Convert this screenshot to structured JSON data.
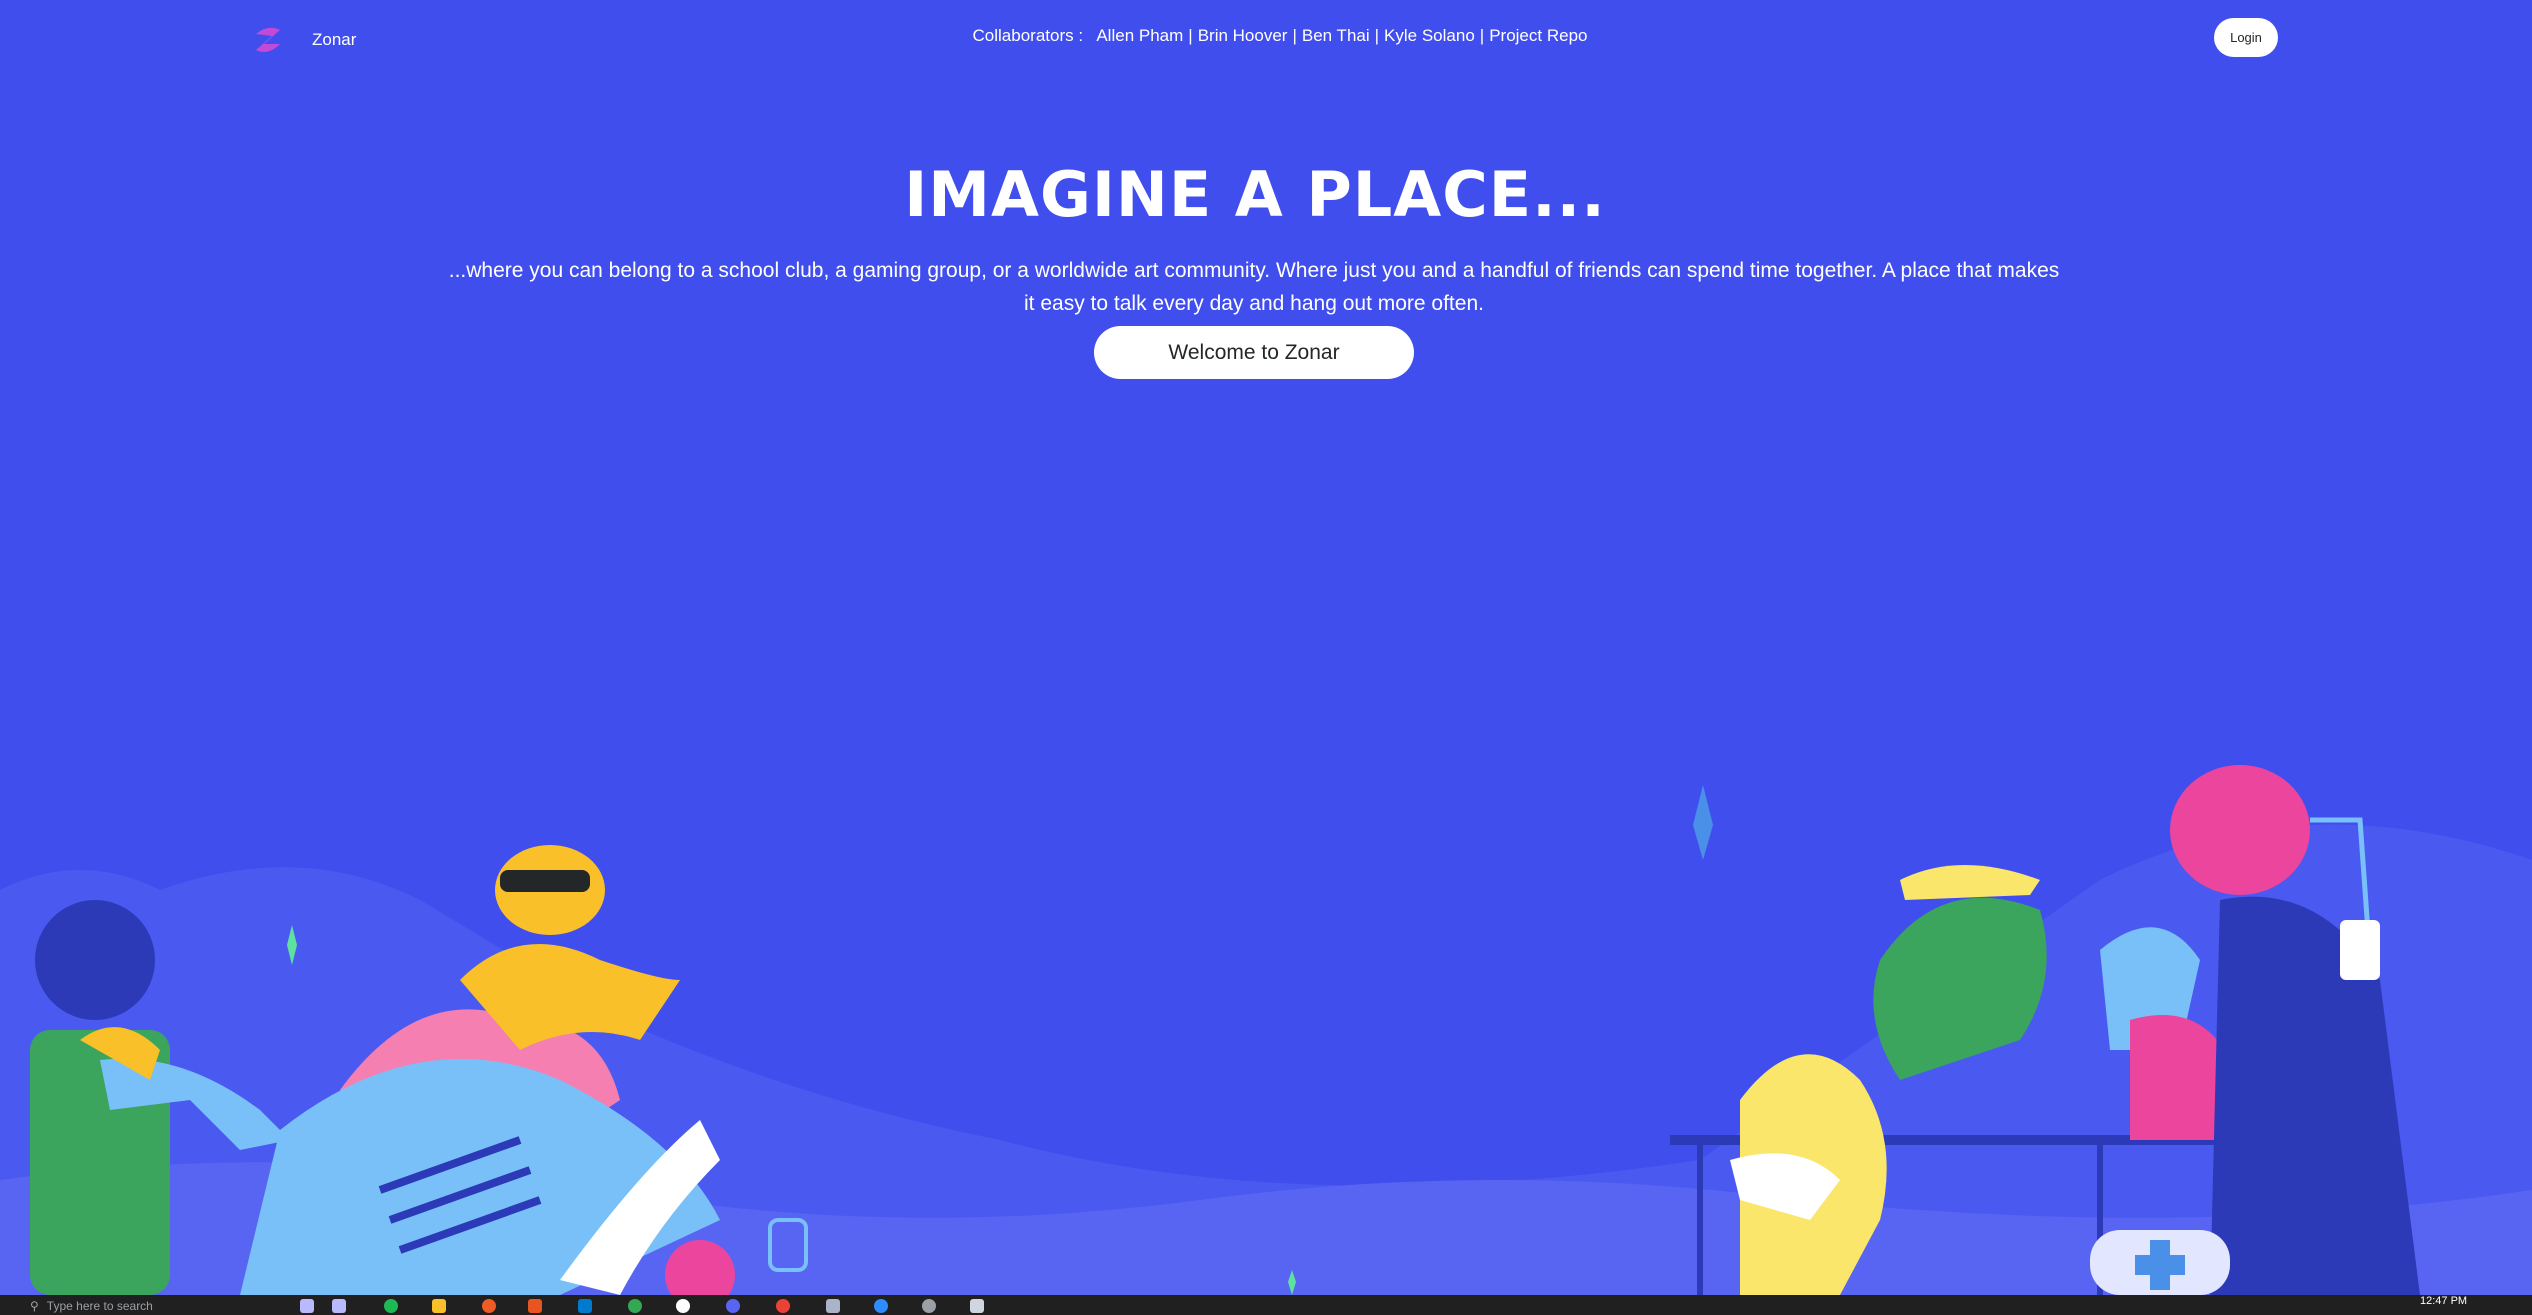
{
  "brand": {
    "name": "Zonar"
  },
  "nav": {
    "collaborators_label": "Collaborators :",
    "collaborators": [
      "Allen Pham",
      "Brin Hoover",
      "Ben Thai",
      "Kyle Solano",
      "Project Repo"
    ],
    "login": "Login"
  },
  "hero": {
    "title": "IMAGINE A PLACE...",
    "text": "...where you can belong to a school club, a gaming group, or a worldwide art community. Where just you and a handful of friends can spend time together. A place that makes it easy to talk every day and hang out more often.",
    "cta": "Welcome to Zonar"
  },
  "taskbar": {
    "search_placeholder": "Type here to search",
    "time": "12:47 PM",
    "icons": [
      "task-view-icon",
      "app-icon",
      "spotify-icon",
      "folder-icon",
      "postman-icon",
      "ubuntu-icon",
      "vscode-icon",
      "chrome-icon",
      "app-icon",
      "discord-icon",
      "chrome-icon",
      "app-icon",
      "zoom-icon",
      "app-icon",
      "app-icon"
    ]
  },
  "colors": {
    "background": "#404eed",
    "button_bg": "#ffffff",
    "button_text": "#23272a"
  }
}
